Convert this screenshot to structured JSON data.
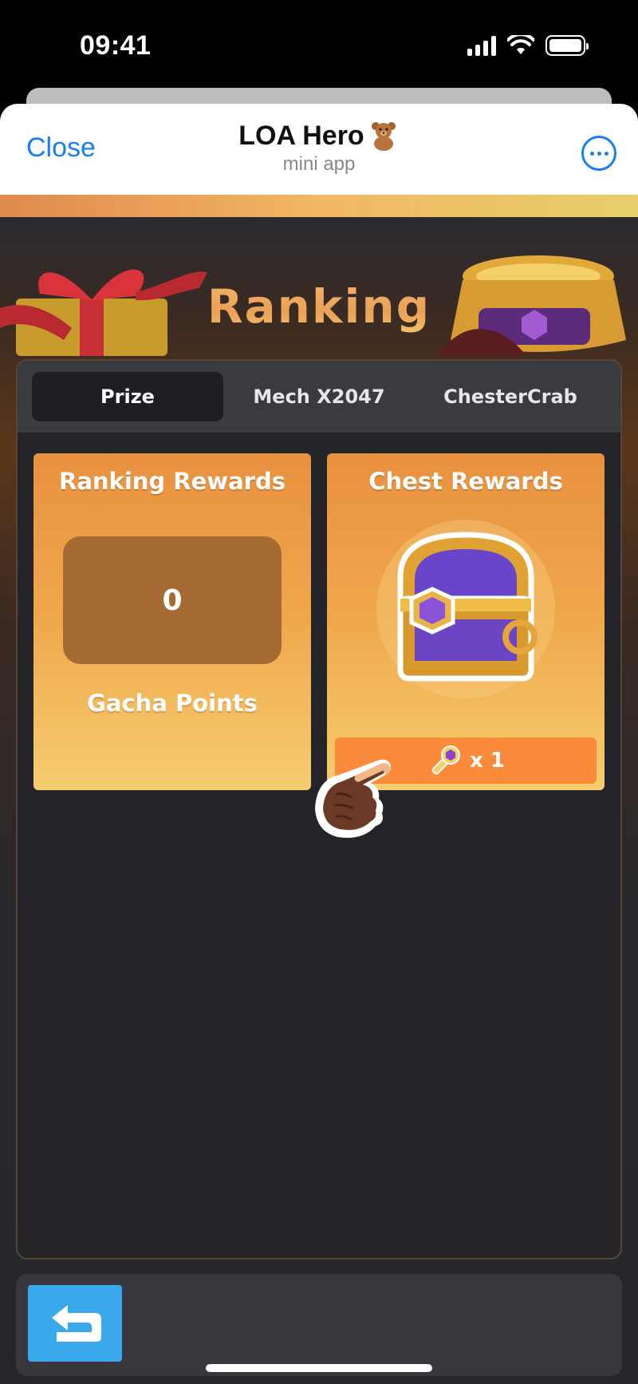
{
  "status": {
    "time": "09:41"
  },
  "header": {
    "close_label": "Close",
    "title": "LOA Hero",
    "subtitle": "mini app"
  },
  "banner": {
    "title": "Ranking"
  },
  "tabs": [
    {
      "label": "Prize",
      "active": true
    },
    {
      "label": "Mech X2047",
      "active": false
    },
    {
      "label": "ChesterCrab",
      "active": false
    }
  ],
  "ranking_card": {
    "title": "Ranking Rewards",
    "points_value": "0",
    "points_label": "Gacha Points"
  },
  "chest_card": {
    "title": "Chest Rewards",
    "key_count": "x 1"
  },
  "icons": {
    "bear": "teddy-bear-icon",
    "more": "more-dots-icon",
    "key": "key-icon",
    "back": "return-arrow-icon",
    "hand": "pointing-hand-icon",
    "chest": "treasure-chest-icon"
  },
  "colors": {
    "accent_blue": "#1a7ef0",
    "card_orange": "#f0a84c",
    "key_bar": "#fb8b3a",
    "back_button": "#3aa9ec"
  }
}
